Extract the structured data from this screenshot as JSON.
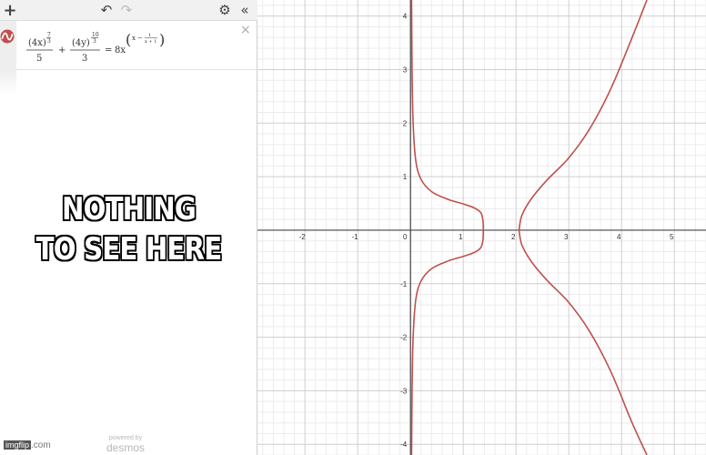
{
  "toolbar": {
    "add_icon": "plus-icon",
    "add_label": "+",
    "undo_icon": "undo-icon",
    "undo_label": "↶",
    "redo_icon": "redo-icon",
    "redo_label": "↷",
    "settings_icon": "wrench-icon",
    "settings_label": "⚙",
    "collapse_icon": "double-chevron-left-icon",
    "collapse_label": "«"
  },
  "expression": {
    "icon": "desmos-graph-color-icon",
    "color": "#c0504d",
    "close_label": "×",
    "formula": {
      "term1_base": "(4x)",
      "term1_exp_num": "7",
      "term1_exp_den": "3",
      "term1_den": "5",
      "plus": "+",
      "term2_base": "(4y)",
      "term2_exp_num": "10",
      "term2_exp_den": "3",
      "term2_den": "3",
      "equals": "=",
      "rhs_coef": "8x",
      "rhs_exp_x": "x −",
      "rhs_exp_frac_num": "1",
      "rhs_exp_frac_den": "x + 1"
    }
  },
  "meme_caption": {
    "line1": "NOTHING",
    "line2": "TO SEE HERE"
  },
  "powered_by": {
    "label": "powered by",
    "logo": "desmos"
  },
  "watermark": {
    "box": "imgflip",
    "text": ".com"
  },
  "chart_data": {
    "type": "line",
    "title": "",
    "xlabel": "",
    "ylabel": "",
    "xlim": [
      -2.9,
      5.6
    ],
    "ylim": [
      -4.2,
      4.3
    ],
    "grid": true,
    "x_ticks": [
      -2,
      -1,
      0,
      1,
      2,
      3,
      4,
      5
    ],
    "y_ticks": [
      -4,
      -3,
      -2,
      -1,
      1,
      2,
      3,
      4
    ],
    "x_tick_labels": [
      "-2",
      "-1",
      "0",
      "1",
      "2",
      "3",
      "4",
      "5"
    ],
    "y_tick_labels": [
      "-4",
      "-3",
      "-2",
      "-1",
      "1",
      "2",
      "3",
      "4"
    ],
    "series": [
      {
        "color": "#c0504d",
        "points": [
          [
            0.02,
            4.3
          ],
          [
            0.03,
            3.0
          ],
          [
            0.05,
            2.0
          ],
          [
            0.1,
            1.3
          ],
          [
            0.2,
            0.95
          ],
          [
            0.4,
            0.72
          ],
          [
            0.7,
            0.58
          ],
          [
            1.0,
            0.49
          ],
          [
            1.2,
            0.42
          ],
          [
            1.33,
            0.33
          ],
          [
            1.37,
            0.2
          ],
          [
            1.38,
            0.0
          ],
          [
            1.37,
            -0.2
          ],
          [
            1.33,
            -0.33
          ],
          [
            1.2,
            -0.42
          ],
          [
            1.0,
            -0.49
          ],
          [
            0.7,
            -0.58
          ],
          [
            0.4,
            -0.72
          ],
          [
            0.2,
            -0.95
          ],
          [
            0.1,
            -1.3
          ],
          [
            0.05,
            -2.0
          ],
          [
            0.03,
            -3.0
          ],
          [
            0.02,
            -4.2
          ]
        ]
      },
      {
        "color": "#c0504d",
        "points": [
          [
            4.48,
            4.3
          ],
          [
            4.2,
            3.6
          ],
          [
            3.8,
            2.65
          ],
          [
            3.4,
            1.9
          ],
          [
            3.0,
            1.35
          ],
          [
            2.6,
            0.95
          ],
          [
            2.3,
            0.6
          ],
          [
            2.12,
            0.3
          ],
          [
            2.07,
            0.1
          ],
          [
            2.06,
            0.0
          ],
          [
            2.07,
            -0.1
          ],
          [
            2.12,
            -0.3
          ],
          [
            2.3,
            -0.6
          ],
          [
            2.6,
            -0.95
          ],
          [
            3.0,
            -1.35
          ],
          [
            3.4,
            -1.9
          ],
          [
            3.8,
            -2.65
          ],
          [
            4.2,
            -3.6
          ],
          [
            4.48,
            -4.2
          ]
        ]
      }
    ]
  }
}
